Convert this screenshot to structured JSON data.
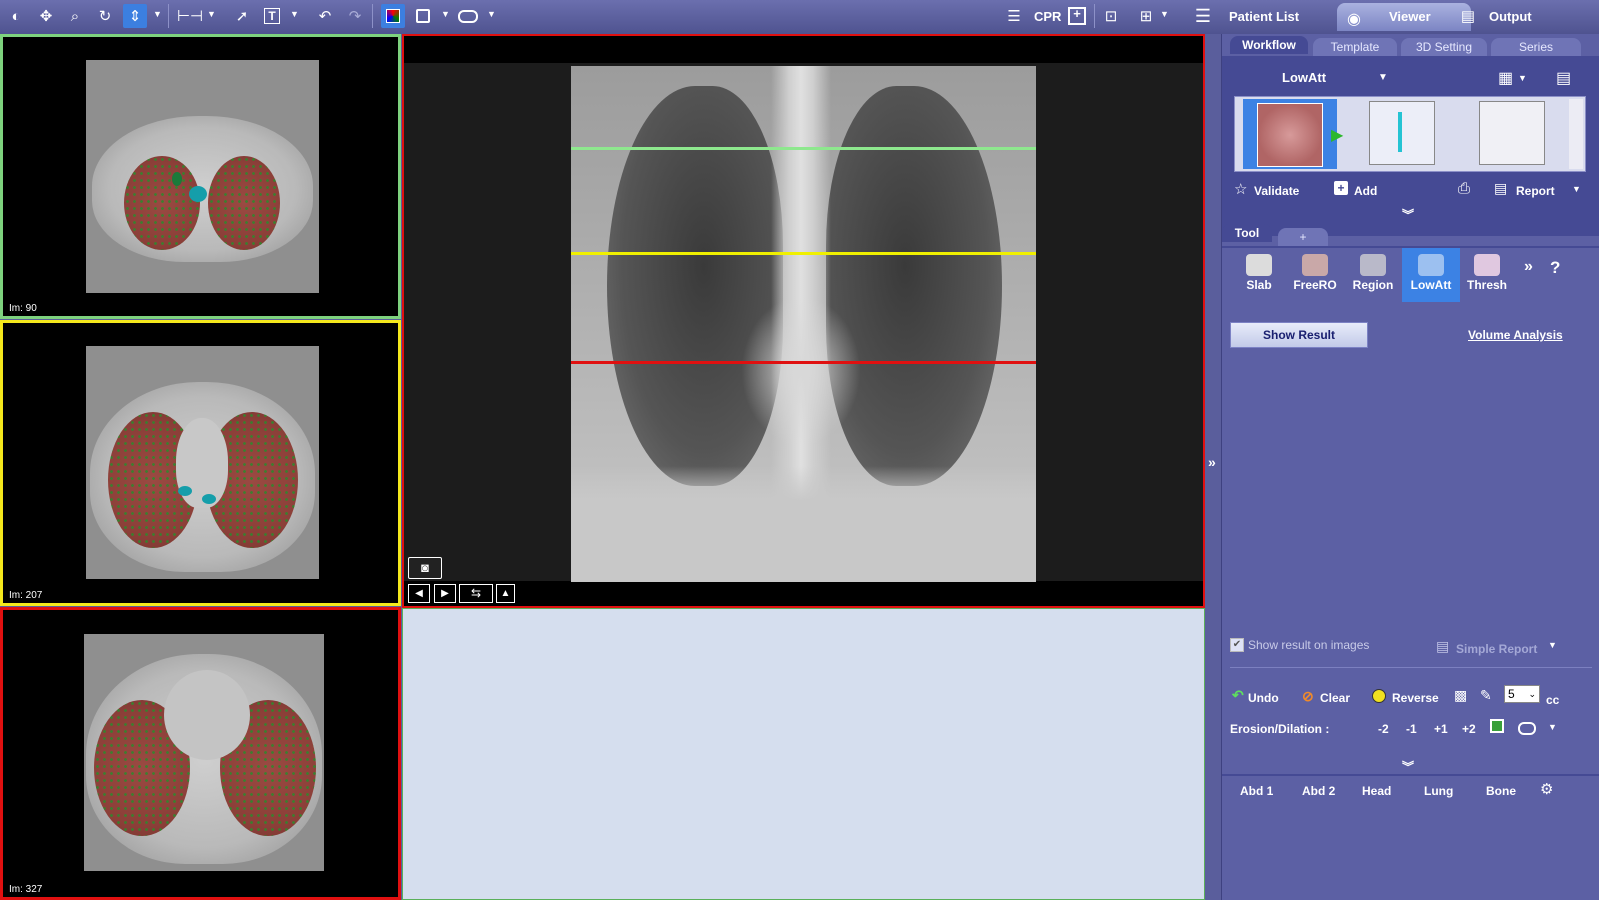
{
  "toolbar": {
    "cpr_label": "CPR",
    "patient_list_label": "Patient List",
    "viewer_label": "Viewer",
    "output_label": "Output"
  },
  "viewports": {
    "axial_1_label": "Im: 90",
    "axial_2_label": "Im: 207",
    "axial_3_label": "Im: 327"
  },
  "panel": {
    "tabs": [
      "Workflow",
      "Template",
      "3D Setting",
      "Series"
    ],
    "protocol": "LowAtt",
    "validate_label": "Validate",
    "add_label": "Add",
    "report_label": "Report",
    "tool_tabs": [
      "Tool",
      "+"
    ],
    "tools": [
      "Slab",
      "FreeRO",
      "Region",
      "LowAtt",
      "Thresh"
    ],
    "show_result_label": "Show Result",
    "volume_analysis_label": "Volume Analysis",
    "show_result_on_images_label": "Show result on images",
    "simple_report_label": "Simple Report",
    "undo_label": "Undo",
    "clear_label": "Clear",
    "reverse_label": "Reverse",
    "brush_size_value": "5",
    "brush_unit": "cc",
    "erosion_label": "Erosion/Dilation :",
    "erosion_steps": [
      "-2",
      "-1",
      "+1",
      "+2"
    ],
    "presets": [
      "Abd 1",
      "Abd 2",
      "Head",
      "Lung",
      "Bone"
    ]
  },
  "colors": {
    "accent": "#3c82e4",
    "panel_bg": "#5c60a4",
    "line_green": "#8ee88e",
    "line_yellow": "#f0f000",
    "line_red": "#e01010"
  }
}
